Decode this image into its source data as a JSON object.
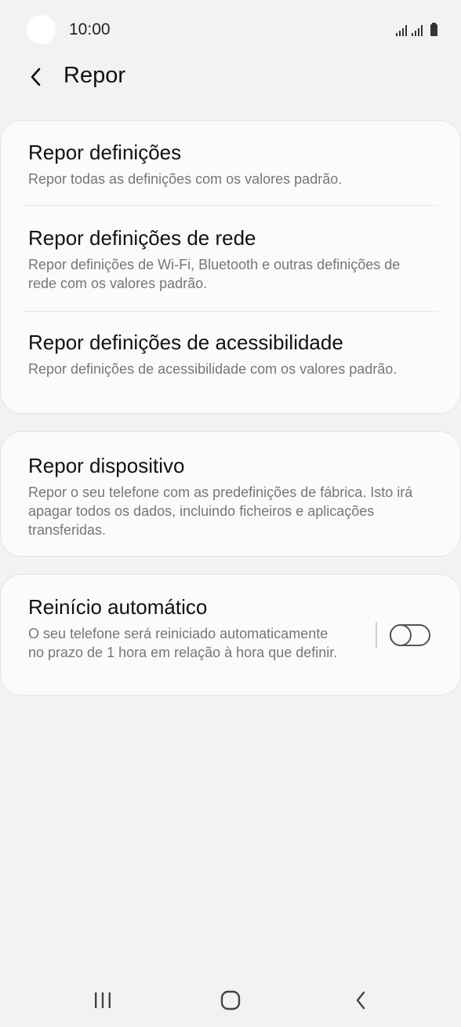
{
  "status_bar": {
    "time": "10:00",
    "icons": [
      "signal-icon",
      "signal-icon",
      "battery-icon"
    ]
  },
  "header": {
    "back_icon": "chevron-left-icon",
    "title": "Repor"
  },
  "group1": {
    "items": [
      {
        "title": "Repor definições",
        "description": "Repor todas as definições com os valores padrão."
      },
      {
        "title": "Repor definições de rede",
        "description": "Repor definições de Wi-Fi, Bluetooth e outras definições de rede com os valores padrão."
      },
      {
        "title": "Repor definições de acessibilidade",
        "description": "Repor definições de acessibilidade com os valores padrão."
      }
    ]
  },
  "group2": {
    "title": "Repor dispositivo",
    "description": "Repor o seu telefone com as predefinições de fábrica. Isto irá apagar todos os dados, incluindo ficheiros e aplicações transferidas."
  },
  "group3": {
    "title": "Reinício automático",
    "description": "O seu telefone será reiniciado automaticamente no prazo de 1 hora em relação à hora que definir.",
    "toggle_on": false
  },
  "nav_bar": {
    "icons": [
      "recents-icon",
      "home-icon",
      "back-icon"
    ]
  }
}
